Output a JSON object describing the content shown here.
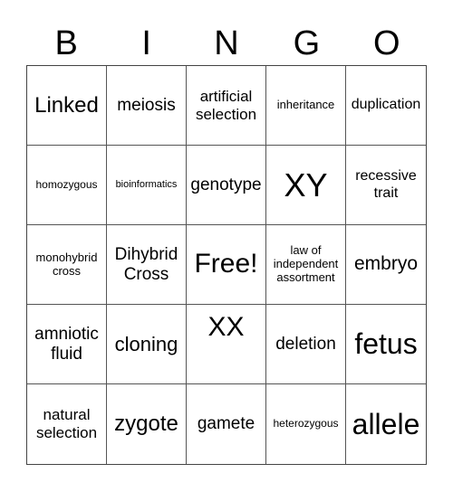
{
  "title_letters": [
    "B",
    "I",
    "N",
    "G",
    "O"
  ],
  "board": {
    "rows": [
      [
        "Linked",
        "meiosis",
        "artificial selection",
        "inheritance",
        "duplication"
      ],
      [
        "homozygous",
        "bioinformatics",
        "genotype",
        "XY",
        "recessive trait"
      ],
      [
        "monohybrid cross",
        "Dihybrid Cross",
        "Free!",
        "law of independent assortment",
        "embryo"
      ],
      [
        "amniotic fluid",
        "cloning",
        "XX",
        "deletion",
        "fetus"
      ],
      [
        "natural selection",
        "zygote",
        "gamete",
        "heterozygous",
        "allele"
      ]
    ]
  }
}
